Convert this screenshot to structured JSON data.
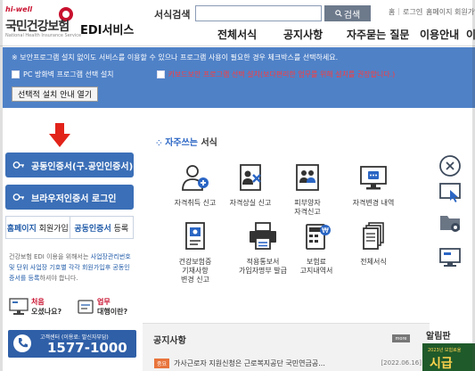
{
  "header": {
    "logo_hiwell": "hi-well",
    "logo_org": "국민건강보험",
    "logo_org_en": "National Health Insurance Service",
    "service_name": "EDI서비스",
    "search_label": "서식검색",
    "search_value": "",
    "search_button": "검색",
    "util_links": [
      "홈",
      "로그인",
      "홈페이지 회원가입"
    ],
    "gnb": [
      "전체서식",
      "공지사항",
      "자주묻는 질문",
      "이용안내",
      "이용"
    ]
  },
  "notice_bar": {
    "message": "※ 보안프로그램 설치 없이도 서비스를 이용할 수 있으나 프로그램 사용이 필요한 경우 체크박스를 선택하세요.",
    "option1": "PC 방화벽 프로그램 선택 설치",
    "option2": "키보드보안 프로그램 선택 설치(보다편리한 업무를 위해 설치를 권장합니다.)",
    "guide_button": "선택적 설치 안내 열기"
  },
  "left": {
    "btn_cert": "공동인증서(구.공인인증서)",
    "btn_browser_cert": "브라우저인증서 로그인",
    "homepage_join_1": "홈페이지",
    "homepage_join_2": "회원가입",
    "cert_register_1": "공동인증서",
    "cert_register_2": "등록",
    "desc_1": "건강보험 EDI 이용을 위해서는 ",
    "desc_hl": "사업장관리번호 및 단위 사업장 기호별 각각 회원가입후 공동인증서를 등록",
    "desc_2": "하셔야 합니다.",
    "first_visit_t1": "처음",
    "first_visit_t2": "오셨나요?",
    "agent_t1": "업무",
    "agent_t2": "대행이란?",
    "call_center_small": "고객센터 (이용료: 발신자부담)",
    "call_center_number": "1577-1000"
  },
  "main": {
    "forms_title_blue": "자주쓰는",
    "forms_title_rest": "서식",
    "forms": [
      {
        "label": "자격취득 신고",
        "icon": "person-add-icon"
      },
      {
        "label": "자격상실 신고",
        "icon": "person-remove-icon"
      },
      {
        "label": "피부양자\n자격신고",
        "icon": "family-icon"
      },
      {
        "label": "자격변경 내역",
        "icon": "monitor-chat-icon"
      },
      {
        "label": "건강보험증\n기재사항\n변경 신고",
        "icon": "insurance-card-icon"
      },
      {
        "label": "적용통보서\n가입자명부 발급",
        "icon": "printer-icon"
      },
      {
        "label": "보험료\n고지내역서",
        "icon": "calculator-icon"
      },
      {
        "label": "전체서식",
        "icon": "documents-icon"
      }
    ],
    "notice_title": "공지사항",
    "more": "more",
    "notice_tag": "중요",
    "notice_text": "가사근로자 지원신청은 근로복지공단  국민연금공...",
    "notice_date": "[2022.06.16]"
  },
  "right": {
    "alim_title": "알림판",
    "ad_year": "2023년 보험료율",
    "ad_text": "시급"
  }
}
